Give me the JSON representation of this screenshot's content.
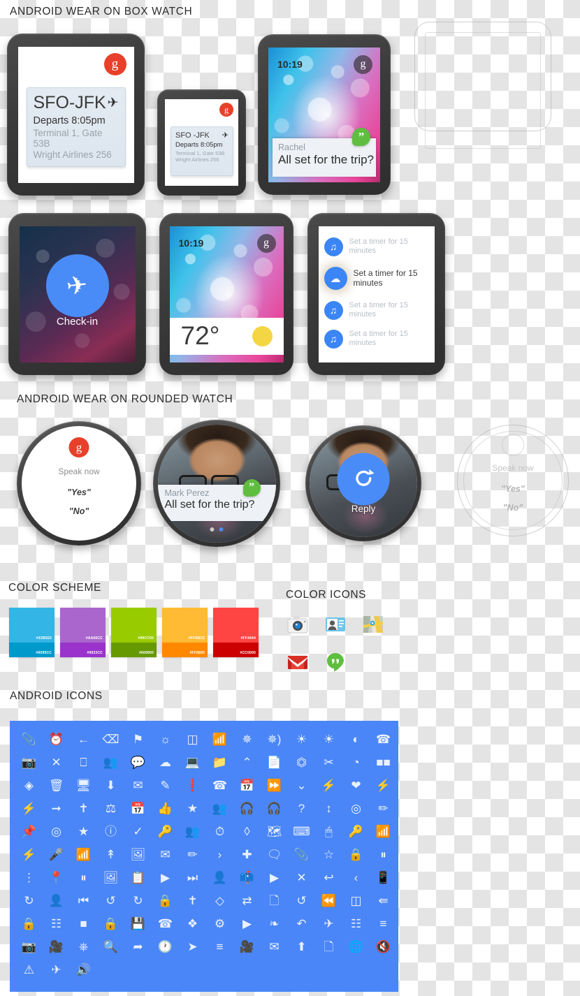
{
  "sections": {
    "box_watch": "ANDROID WEAR ON BOX WATCH",
    "rounded_watch": "ANDROID WEAR ON ROUNDED WATCH",
    "color_scheme": "COLOR SCHEME",
    "color_icons": "COLOR ICONS",
    "android_icons": "ANDROID ICONS"
  },
  "flight_card_large": {
    "badge": "g",
    "route": "SFO-JFK",
    "plane_icon": "airplane-icon",
    "departs": "Departs 8:05pm",
    "terminal": "Terminal 1, Gate 53B",
    "airline": "Wright Airlines 256"
  },
  "flight_card_small": {
    "badge": "g",
    "route": "SFO -JFK",
    "plane_icon": "airplane-icon",
    "departs": "Departs 8:05pm",
    "terminal": "Terminal 1, Gate 53B",
    "airline": "Wright Airlines 256"
  },
  "hangout_watch": {
    "time": "10:19",
    "badge": "g",
    "hangout_glyph": "”",
    "sender": "Rachel",
    "message": "All set for the trip?"
  },
  "checkin_watch": {
    "icon": "airplane-icon",
    "label": "Check-in"
  },
  "weather_watch": {
    "time": "10:19",
    "badge": "g",
    "temperature": "72°",
    "sun_icon": "sun-icon"
  },
  "timer_watch": {
    "items": [
      {
        "icon": "headphones-icon",
        "text": "Set a timer for 15 minutes",
        "active": false
      },
      {
        "icon": "cloud-icon",
        "text": "Set a timer for 15 minutes",
        "active": true
      },
      {
        "icon": "headphones-icon",
        "text": "Set a timer for 15 minutes",
        "active": false
      },
      {
        "icon": "headphones-icon",
        "text": "Set a timer for 15 minutes",
        "active": false
      }
    ]
  },
  "round_voice": {
    "badge": "g",
    "prompt": "Speak now",
    "option_yes": "\"Yes\"",
    "option_no": "\"No\""
  },
  "round_message": {
    "sender": "Mark Perez",
    "message": "All set for the trip?",
    "hangout_glyph": "”"
  },
  "round_reply": {
    "icon": "reply-rotate-icon",
    "label": "Reply"
  },
  "round_ghost": {
    "prompt": "Speak now",
    "option_yes": "\"Yes\"",
    "option_no": "\"No\""
  },
  "color_scheme": {
    "swatches": [
      {
        "top_hex": "#33B5E5",
        "top_label": "#33B5E5",
        "bottom_hex": "#0099CC",
        "bottom_label": "#0099CC"
      },
      {
        "top_hex": "#AA66CC",
        "top_label": "#AA66CC",
        "bottom_hex": "#9933CC",
        "bottom_label": "#9933CC"
      },
      {
        "top_hex": "#99CC00",
        "top_label": "#99CC00",
        "bottom_hex": "#669900",
        "bottom_label": "#669900"
      },
      {
        "top_hex": "#FFBB33",
        "top_label": "#FFBB33",
        "bottom_hex": "#FF8800",
        "bottom_label": "#FF8800"
      },
      {
        "top_hex": "#FF4444",
        "top_label": "#FF4444",
        "bottom_hex": "#CC0000",
        "bottom_label": "#CC0000"
      }
    ]
  },
  "color_icons": {
    "items": [
      {
        "name": "camera-icon"
      },
      {
        "name": "contacts-icon"
      },
      {
        "name": "maps-icon"
      },
      {
        "name": "gmail-icon"
      },
      {
        "name": "hangouts-icon"
      }
    ]
  },
  "android_icons": {
    "panel_color": "#4A86F7",
    "glyph_color": "#E9F0FE",
    "rows": [
      [
        "attachment-icon",
        "alarm-icon",
        "arrow-back-icon",
        "backspace-icon",
        "bookmark-icon",
        "brightness-icon",
        "battery-icon",
        "bluetooth-searching-icon",
        "bluetooth-icon",
        "bluetooth-audio-icon",
        "brightness-auto-icon",
        "brightness-high-icon",
        "brightness-medium-icon",
        "call-icon"
      ],
      [
        "camera-icon",
        "close-icon",
        "cast-icon",
        "group-add-icon",
        "chat-icon",
        "cloud-icon",
        "laptop-icon",
        "folder-icon",
        "chevron-up-icon",
        "copy-icon",
        "crop-icon",
        "cut-icon",
        "pie-chart-icon",
        "dialpad-icon"
      ],
      [
        "navigation-icon",
        "delete-icon",
        "desktop-icon",
        "download-icon",
        "email-icon",
        "edit-icon",
        "error-icon",
        "call-end-icon",
        "event-icon",
        "fast-forward-icon",
        "chevron-down-icon",
        "flash-off-icon",
        "favorite-icon",
        "flash-auto-icon"
      ],
      [
        "flash-icon",
        "arrow-forward-icon",
        "fullscreen-exit-icon",
        "gamepad-icon",
        "calendar-icon",
        "thumb-up-icon",
        "star-half-icon",
        "group-icon",
        "headset-mic-icon",
        "headphones-icon",
        "help-icon",
        "swap-vert-icon",
        "gps-icon",
        "pencil-ruler-icon"
      ],
      [
        "pin-icon",
        "my-location-icon",
        "star-icon",
        "info-icon",
        "check-icon",
        "key-icon",
        "group-add-2-icon",
        "history-add-icon",
        "filter-center-icon",
        "map-icon",
        "keyboard-icon",
        "mouse-icon",
        "key-add-icon",
        "signal-bars-icon"
      ],
      [
        "flash-off-2-icon",
        "mic-icon",
        "wifi-icon",
        "merge-icon",
        "add-photo-icon",
        "add-email-icon",
        "add-edit-icon",
        "chevron-right-icon",
        "add-icon",
        "add-comment-icon",
        "add-attachment-icon",
        "star-outline-icon",
        "lock-icon",
        "pause-circle-icon"
      ],
      [
        "more-vert-icon",
        "place-icon",
        "pause-icon",
        "image-icon",
        "clipboard-icon",
        "play-circle-icon",
        "skip-next-icon",
        "person-add-icon",
        "open-mail-icon",
        "play-icon",
        "close-2-icon",
        "reply-icon",
        "chevron-left-icon",
        "smartphone-icon"
      ],
      [
        "sync-icon",
        "account-icon",
        "skip-previous-icon",
        "rotate-left-icon",
        "rotate-right-icon",
        "screen-lock-icon",
        "fullscreen-exit-2-icon",
        "screen-rotation-icon",
        "repeat-icon",
        "window-add-icon",
        "restore-icon",
        "rewind-icon",
        "battery-std-icon",
        "reply-all-icon"
      ],
      [
        "screen-lock-portrait-icon",
        "apps-icon",
        "stop-icon",
        "lock-closed-icon",
        "save-icon",
        "phone-in-talk-icon",
        "shuffle-icon",
        "settings-icon",
        "play-box-icon",
        "share-icon",
        "undo-icon",
        "airplane-icon",
        "view-module-icon",
        "sort-icon"
      ],
      [
        "switch-camera-icon",
        "videocam-icon",
        "usb-icon",
        "search-icon",
        "send-icon",
        "clock-icon",
        "send-2-icon",
        "view-list-icon",
        "video-rotate-icon",
        "mail-read-icon",
        "upload-icon",
        "article-icon",
        "globe-icon",
        "volume-off-icon"
      ],
      [
        "warning-icon",
        "airplane-2-icon",
        "volume-up-icon"
      ]
    ]
  }
}
